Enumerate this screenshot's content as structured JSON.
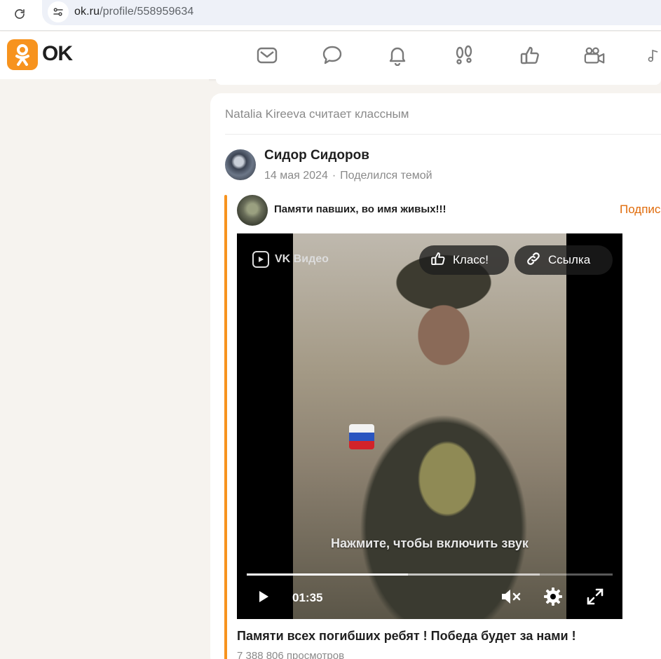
{
  "browser": {
    "url_host": "ok.ru",
    "url_path": "/profile/558959634"
  },
  "header": {
    "logo_text": "OK",
    "nav_icons": [
      "mail-icon",
      "chat-icon",
      "bell-icon",
      "footprints-icon",
      "thumbs-up-icon",
      "video-camera-icon",
      "music-note-icon"
    ]
  },
  "feed": {
    "liker_line": "Natalia Kireeva считает классным",
    "author": {
      "name": "Сидор Сидоров",
      "date": "14 мая 2024",
      "separator": "·",
      "action": "Поделился темой"
    },
    "group": {
      "title": "Памяти павших, во имя живых!!!",
      "subscribe_label": "Подпис"
    },
    "video": {
      "brand": "VK Видео",
      "like_label": "Класс!",
      "link_label": "Ссылка",
      "unmute_hint": "Нажмите, чтобы включить звук",
      "time": "01:35",
      "progress": 0.44,
      "buffered": 0.8,
      "title": "Памяти всех погибших ребят ! Победа будет за нами !",
      "views": "7 388 806 просмотров"
    }
  },
  "colors": {
    "accent": "#f7931e",
    "subscribe": "#e06b0a"
  }
}
